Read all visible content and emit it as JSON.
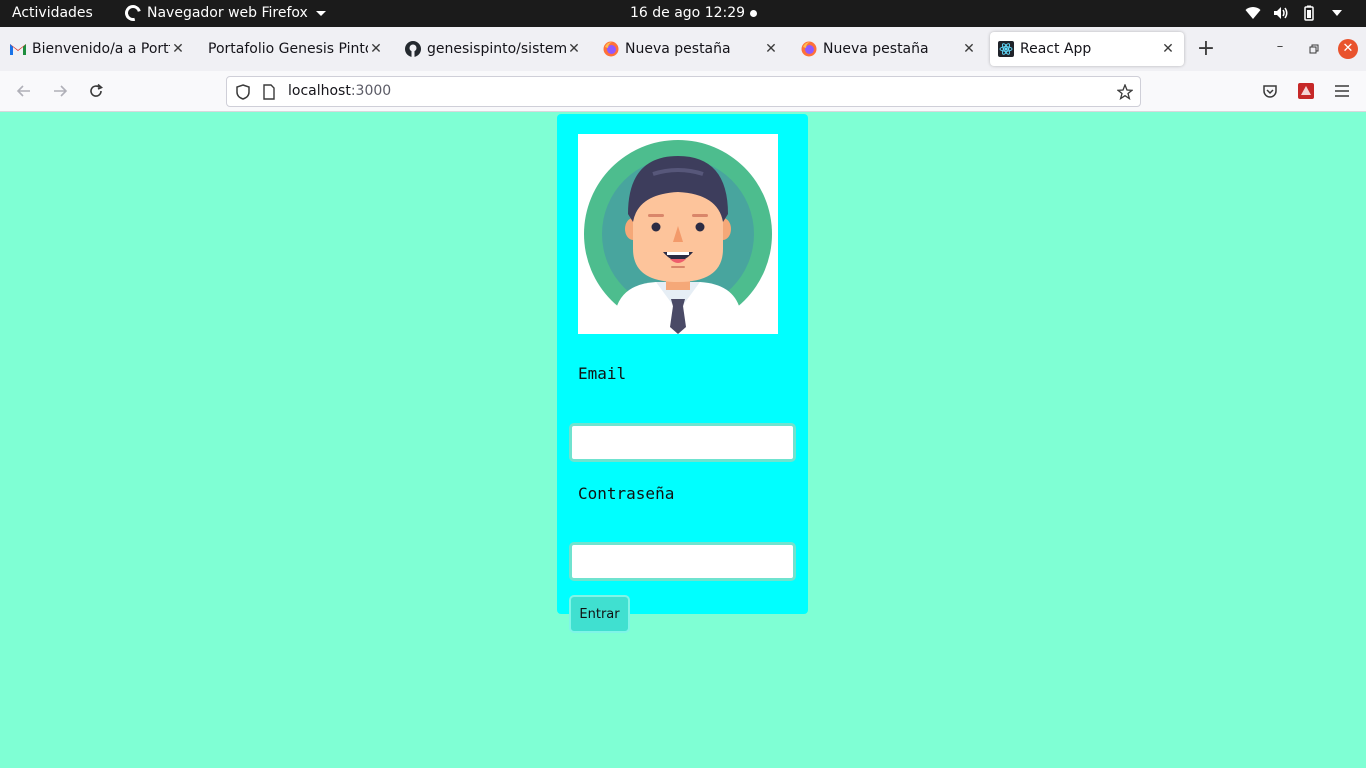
{
  "system_bar": {
    "activities": "Actividades",
    "app_name": "Navegador web Firefox",
    "clock": "16 de ago  12:29"
  },
  "tabs": [
    {
      "title": "Bienvenido/a a Portfo",
      "favicon": "gmail-icon"
    },
    {
      "title": "Portafolio Genesis Pinto",
      "favicon": "none"
    },
    {
      "title": "genesispinto/sistema",
      "favicon": "github-icon"
    },
    {
      "title": "Nueva pestaña",
      "favicon": "firefox-icon"
    },
    {
      "title": "Nueva pestaña",
      "favicon": "firefox-icon"
    },
    {
      "title": "React App",
      "favicon": "react-icon",
      "active": true
    }
  ],
  "address_bar": {
    "host": "localhost",
    "port": ":3000"
  },
  "login_form": {
    "email_label": "Email",
    "email_value": "",
    "password_label": "Contraseña",
    "password_value": "",
    "submit_label": "Entrar"
  },
  "colors": {
    "page_background": "#7fffd4",
    "card_background": "#00ffff",
    "button_background": "#40e0d0"
  }
}
